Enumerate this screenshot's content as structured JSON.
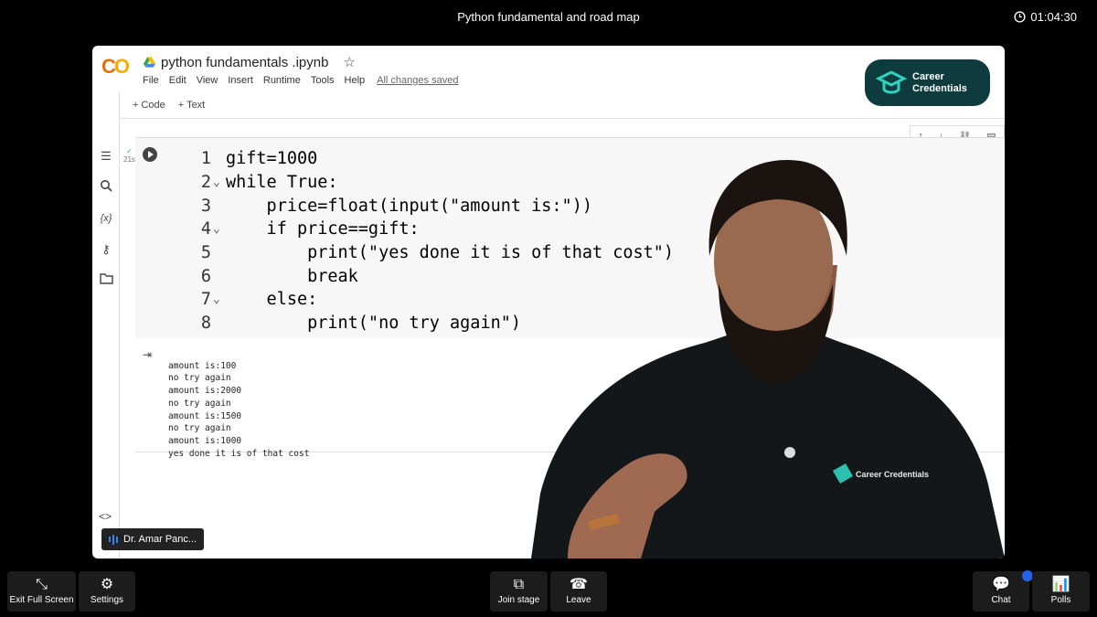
{
  "meeting": {
    "title": "Python fundamental and road map",
    "timer": "01:04:30"
  },
  "colab": {
    "logo": "CO",
    "notebook_title": "python fundamentals .ipynb",
    "menu": [
      "File",
      "Edit",
      "View",
      "Insert",
      "Runtime",
      "Tools",
      "Help"
    ],
    "saved_status": "All changes saved",
    "toolbar": {
      "code_label": "+ Code",
      "text_label": "+ Text"
    },
    "brand": {
      "line1": "Career",
      "line2": "Credentials"
    },
    "exec_time": "21s",
    "code_lines": [
      {
        "n": "1",
        "fold": "",
        "text": "gift=1000"
      },
      {
        "n": "2",
        "fold": "v",
        "text": "while True:"
      },
      {
        "n": "3",
        "fold": "",
        "text": "    price=float(input(\"amount is:\"))"
      },
      {
        "n": "4",
        "fold": "v",
        "text": "    if price==gift:"
      },
      {
        "n": "5",
        "fold": "",
        "text": "        print(\"yes done it is of that cost\")"
      },
      {
        "n": "6",
        "fold": "",
        "text": "        break"
      },
      {
        "n": "7",
        "fold": "v",
        "text": "    else:"
      },
      {
        "n": "8",
        "fold": "",
        "text": "        print(\"no try again\")"
      }
    ],
    "output_lines": [
      "amount is:100",
      "no try again",
      "amount is:2000",
      "no try again",
      "amount is:1500",
      "no try again",
      "amount is:1000",
      "yes done it is of that cost"
    ]
  },
  "presenter": {
    "name": "Dr. Amar Panc...",
    "shirt_brand": "Career Credentials"
  },
  "controls": {
    "exit_full_screen": "Exit Full Screen",
    "settings": "Settings",
    "join_stage": "Join stage",
    "leave": "Leave",
    "chat": "Chat",
    "polls": "Polls"
  },
  "colors": {
    "accent": "#2563eb",
    "brand_bg": "#0d3b3e",
    "brand_accent": "#2dd4bf"
  }
}
